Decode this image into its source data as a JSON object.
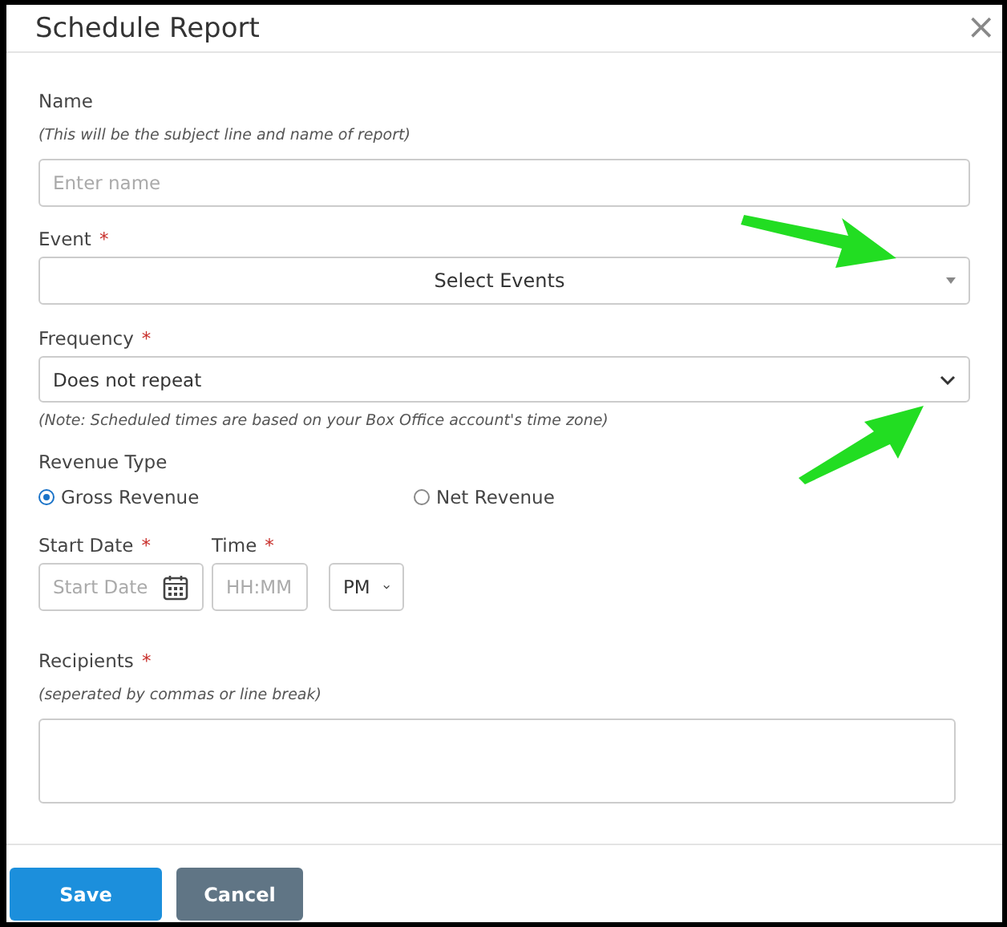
{
  "dialog": {
    "title": "Schedule Report",
    "close": "×"
  },
  "name": {
    "label": "Name",
    "hint": "(This will be the subject line and name of report)",
    "placeholder": "Enter name"
  },
  "event": {
    "label": "Event",
    "required_mark": "*",
    "value": "Select Events"
  },
  "frequency": {
    "label": "Frequency",
    "required_mark": "*",
    "value": "Does not repeat",
    "note": "(Note: Scheduled times are based on your Box Office account's time zone)"
  },
  "revenue_type": {
    "label": "Revenue Type",
    "options": [
      {
        "label": "Gross Revenue",
        "selected": true
      },
      {
        "label": "Net Revenue",
        "selected": false
      }
    ]
  },
  "start_date": {
    "label": "Start Date",
    "required_mark": "*",
    "placeholder": "Start Date"
  },
  "time": {
    "label": "Time",
    "required_mark": "*",
    "placeholder": "HH:MM",
    "period": "PM"
  },
  "recipients": {
    "label": "Recipients",
    "required_mark": "*",
    "hint": "(seperated by commas or line break)"
  },
  "buttons": [
    {
      "label": "Save",
      "kind": "primary"
    },
    {
      "label": "Cancel",
      "kind": "secondary"
    }
  ]
}
